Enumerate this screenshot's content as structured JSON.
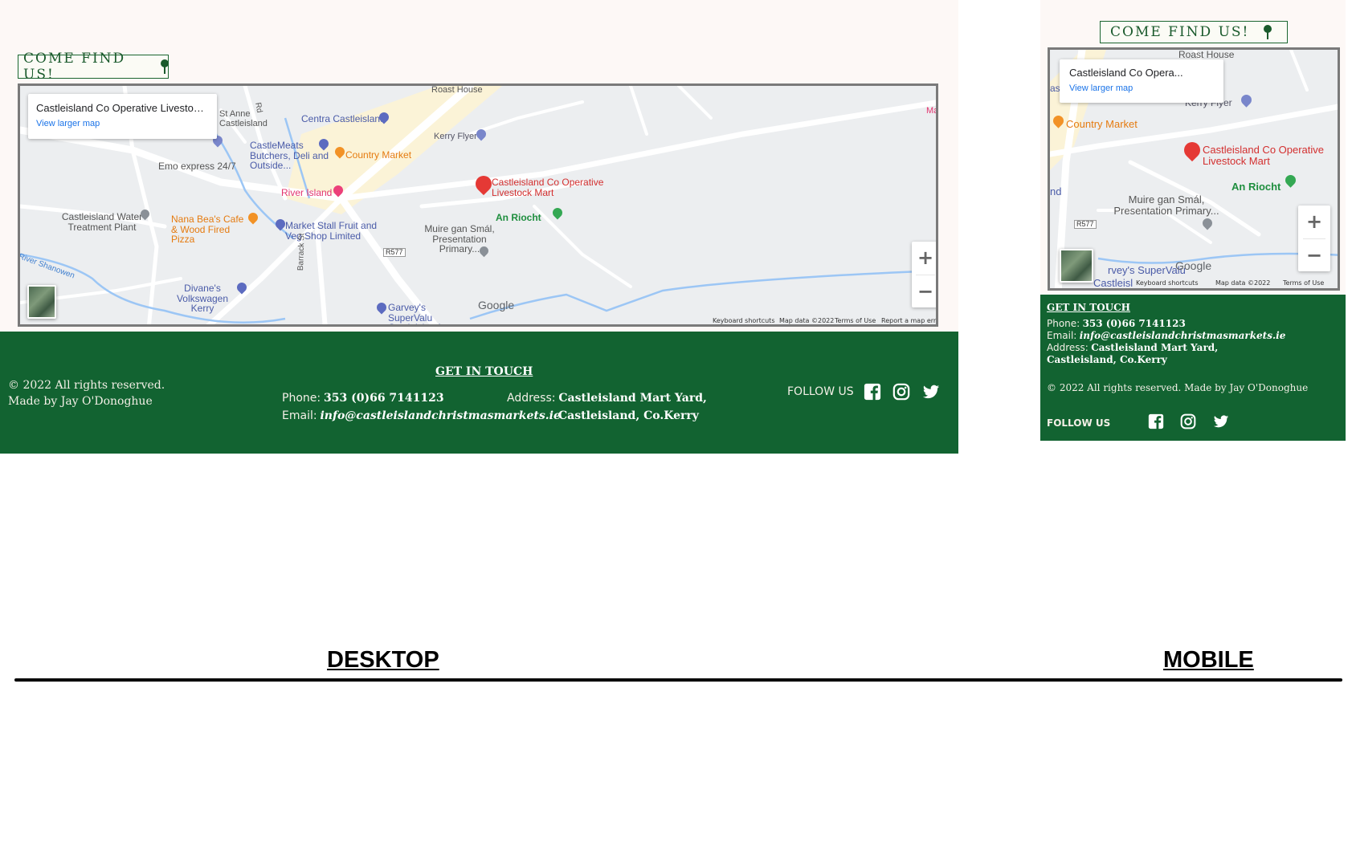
{
  "come_find_us": "COME FIND US!",
  "map": {
    "place_name_desktop": "Castleisland Co Operative Livestock ...",
    "place_name_mobile": "Castleisland Co Opera...",
    "view_larger_map": "View larger map",
    "zoom_in": "+",
    "zoom_out": "−",
    "google": "Google",
    "keyboard_shortcuts": "Keyboard shortcuts",
    "map_data": "Map data ©2022",
    "terms": "Terms of Use",
    "report": "Report a map error",
    "pois": {
      "marker": "Castleisland Co Operative Livestock Mart",
      "roast_house": "Roast House",
      "centra": "Centra Castleisland",
      "kerry_flyer": "Kerry Flyer",
      "country_market": "Country Market",
      "castlemeats": "CastleMeats Butchers, Deli and Outside...",
      "emo": "Emo express 24/7",
      "st_anne": "St Anne Castleisland",
      "river_island": "River Island",
      "water_plant": "Castleisland Water Treatment Plant",
      "nana_beas": "Nana Bea's Cafe & Wood Fired Pizza",
      "market_stall": "Market Stall Fruit and Veg Shop Limited",
      "an_riocht": "An Riocht",
      "muire": "Muire gan Smál, Presentation Primary...",
      "r577": "R577",
      "divanes": "Divane's Volkswagen Kerry",
      "barrack_st": "Barrack St",
      "garveys": "Garvey's SuperValu Castleisland",
      "river_shanowen": "River Shanowen",
      "rd": "Rd",
      "mac": "Mac",
      "nd": "nd",
      "as": "as",
      "garveys_mobile": "rvey's SuperValu",
      "castleisland_mobile": "Castleisl"
    }
  },
  "footer": {
    "copyright_line1": "© 2022 All rights reserved.",
    "copyright_line2": "Made by Jay O'Donoghue",
    "copyright_full": "© 2022 All rights reserved. Made by Jay O'Donoghue",
    "get_in_touch": "GET IN TOUCH",
    "phone_label": "Phone:",
    "phone_value": "353 (0)66 7141123",
    "email_label": "Email:",
    "email_value": "info@castleislandchristmasmarkets.ie",
    "address_label": "Address:",
    "address_line1": "Castleisland Mart Yard,",
    "address_line2": "Castleisland, Co.Kerry",
    "follow_us": "FOLLOW US"
  },
  "labels": {
    "desktop": "DESKTOP",
    "mobile": "MOBILE"
  },
  "colors": {
    "footer_green": "#126331",
    "page_bg": "#fdf8f6",
    "badge_green": "#1a5a2c",
    "marker_red": "#e53935"
  },
  "icons": [
    "map-pin-icon",
    "facebook-icon",
    "instagram-icon",
    "twitter-icon"
  ]
}
